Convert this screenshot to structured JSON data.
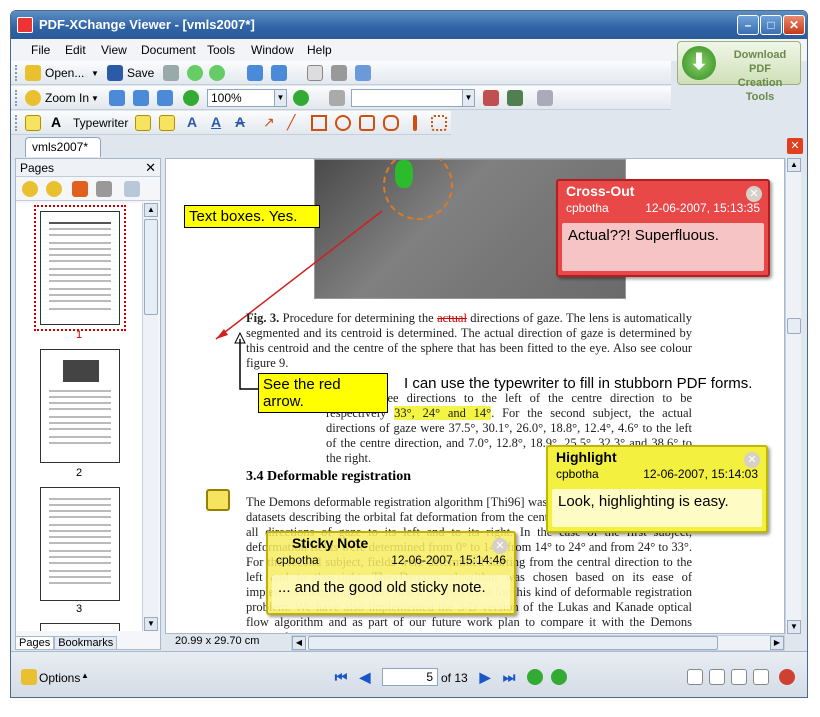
{
  "window": {
    "title": "PDF-XChange Viewer - [vmls2007*]"
  },
  "menu": [
    "File",
    "Edit",
    "View",
    "Document",
    "Tools",
    "Window",
    "Help"
  ],
  "toolbar1": {
    "open": "Open...",
    "save": "Save"
  },
  "toolbar2": {
    "zoom_in": "Zoom In",
    "zoom_value": "100%"
  },
  "toolbar3": {
    "typewriter": "Typewriter"
  },
  "download_box": {
    "line1": "Download PDF",
    "line2": "Creation Tools"
  },
  "doc_tab": "vmls2007*",
  "pages_panel": {
    "title": "Pages",
    "tabs": [
      "Pages",
      "Bookmarks"
    ],
    "thumbs": [
      "1",
      "2",
      "3"
    ]
  },
  "content": {
    "fig_caption_bold": "Fig. 3.",
    "fig_caption_pre": " Procedure for determining the ",
    "fig_caption_strike": "actual",
    "fig_caption_post": " directions of gaze. The lens is automatically segmented and its centroid is determined. The actual direction of gaze is determined by this centroid and the centre of the sphere that has been fitted to the eye. Also see colour figure 9.",
    "para1_pre": "determined the three directions to the left of the centre direction to be respectively ",
    "para1_hl": "33°, 24° and 14°",
    "para1_post": ". For the second subject, the actual directions of gaze were 37.5°, 30.1°, 26.0°, 18.8°, 12.4°, 4.6° to the left of the centre direction, and 7.0°, 12.8°, 18.9°, 25.5°, 32.3° and 38.6° to the right.",
    "heading": "3.4 Deformable registration",
    "para2": "The Demons deformable registration algorithm [Thi96] was used to calculate 3-D vector datasets describing the orbital fat deformation from the central direction of gaze through all directions of gaze to its left and to its right. In the case of the first subject, deformation fields were determined from 0° to 14°, from 14° to 24° and from 24° to 33°. For the second subject, fields were determined starting from the central direction to the left and to the right. The Demons algorithm was chosen based on its ease of implementation, and the fact that it is often used for this kind of deformable registration problem. We have also implemented the 3-D version of the Lukas and Kanade optical flow algorithm and as part of our future work plan to compare it with the Demons approach."
  },
  "annotations": {
    "textbox1": "Text boxes.  Yes.",
    "textbox2": "See the red arrow.",
    "typewriter_text": "I can use the typewriter to fill in stubborn PDF forms.",
    "crossout": {
      "title": "Cross-Out",
      "author": "cpbotha",
      "date": "12-06-2007, 15:13:35",
      "body": "Actual??!  Superfluous."
    },
    "highlight": {
      "title": "Highlight",
      "author": "cpbotha",
      "date": "12-06-2007, 15:14:03",
      "body": "Look, highlighting is easy."
    },
    "sticky": {
      "title": "Sticky Note",
      "author": "cpbotha",
      "date": "12-06-2007, 15:14:46",
      "body": "... and the good old sticky note."
    }
  },
  "statusbar": {
    "page_size": "20.99 x 29.70 cm",
    "options": "Options",
    "current_page": "5",
    "of_pages": "of 13"
  }
}
